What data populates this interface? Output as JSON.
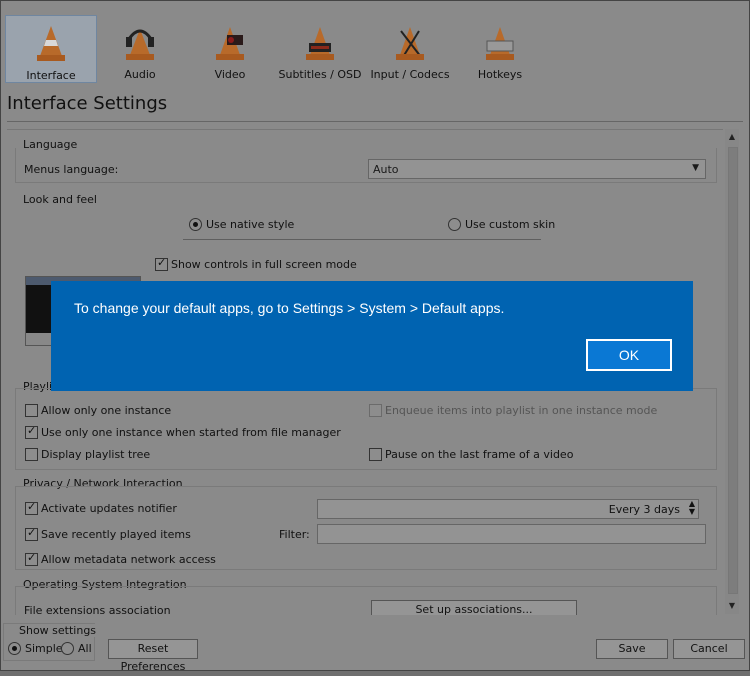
{
  "toolbar": {
    "items": [
      {
        "label": "Interface",
        "icon": "vlc-cone-interface-icon"
      },
      {
        "label": "Audio",
        "icon": "vlc-cone-headphones-icon"
      },
      {
        "label": "Video",
        "icon": "vlc-cone-video-icon"
      },
      {
        "label": "Subtitles / OSD",
        "icon": "vlc-cone-subtitles-icon"
      },
      {
        "label": "Input / Codecs",
        "icon": "vlc-cone-codecs-icon"
      },
      {
        "label": "Hotkeys",
        "icon": "vlc-cone-hotkeys-icon"
      }
    ]
  },
  "page_title": "Interface Settings",
  "language": {
    "section": "Language",
    "menus_label": "Menus language:",
    "menus_value": "Auto"
  },
  "look": {
    "section": "Look and feel",
    "native_style": "Use native style",
    "custom_skin": "Use custom skin",
    "show_controls": "Show controls in full screen mode"
  },
  "playlist": {
    "section": "Playlist",
    "allow_one": "Allow only one instance",
    "enqueue": "Enqueue items into playlist in one instance mode",
    "one_instance_fm": "Use only one instance when started from file manager",
    "display_tree": "Display playlist tree",
    "pause_last": "Pause on the last frame of a video"
  },
  "privacy": {
    "section": "Privacy / Network Interaction",
    "updates": "Activate updates notifier",
    "updates_value": "Every 3 days",
    "recent": "Save recently played items",
    "filter_label": "Filter:",
    "metadata": "Allow metadata network access"
  },
  "os": {
    "section": "Operating System Integration",
    "file_ext": "File extensions association",
    "setup_btn": "Set up associations..."
  },
  "footer": {
    "show_settings": "Show settings",
    "simple": "Simple",
    "all": "All",
    "reset": "Reset Preferences",
    "save": "Save",
    "cancel": "Cancel"
  },
  "dialog": {
    "message": "To change your default apps, go to Settings > System > Default apps.",
    "ok": "OK"
  },
  "colors": {
    "dialog_bg": "#0063b1",
    "ok_button": "#0a78d4"
  }
}
